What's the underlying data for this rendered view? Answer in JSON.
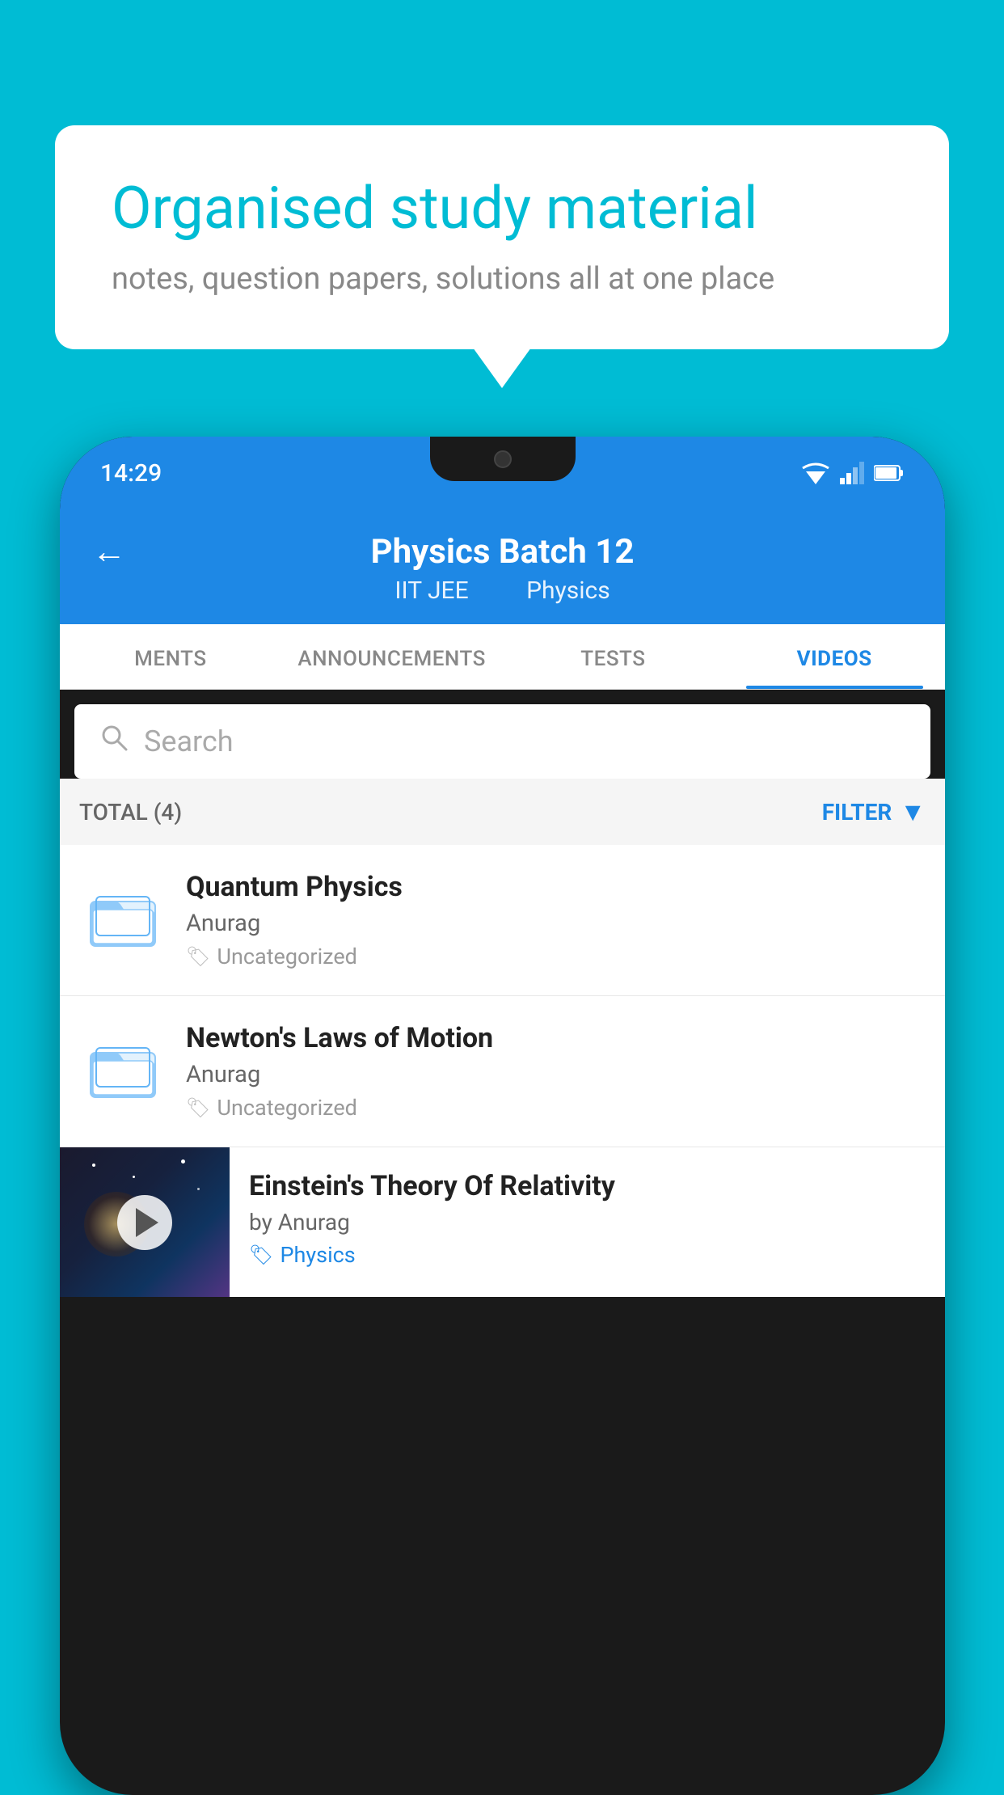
{
  "background": {
    "color": "#00bcd4"
  },
  "speech_bubble": {
    "title": "Organised study material",
    "subtitle": "notes, question papers, solutions all at one place"
  },
  "phone": {
    "status_bar": {
      "time": "14:29"
    },
    "header": {
      "title": "Physics Batch 12",
      "tag1": "IIT JEE",
      "tag2": "Physics",
      "back_label": "←"
    },
    "tabs": [
      {
        "label": "MENTS",
        "active": false
      },
      {
        "label": "ANNOUNCEMENTS",
        "active": false
      },
      {
        "label": "TESTS",
        "active": false
      },
      {
        "label": "VIDEOS",
        "active": true
      }
    ],
    "search": {
      "placeholder": "Search"
    },
    "filter_bar": {
      "total_label": "TOTAL (4)",
      "filter_label": "FILTER"
    },
    "videos": [
      {
        "title": "Quantum Physics",
        "author": "Anurag",
        "tag": "Uncategorized",
        "type": "folder"
      },
      {
        "title": "Newton's Laws of Motion",
        "author": "Anurag",
        "tag": "Uncategorized",
        "type": "folder"
      },
      {
        "title": "Einstein's Theory Of Relativity",
        "author": "by Anurag",
        "tag": "Physics",
        "type": "video"
      }
    ]
  }
}
